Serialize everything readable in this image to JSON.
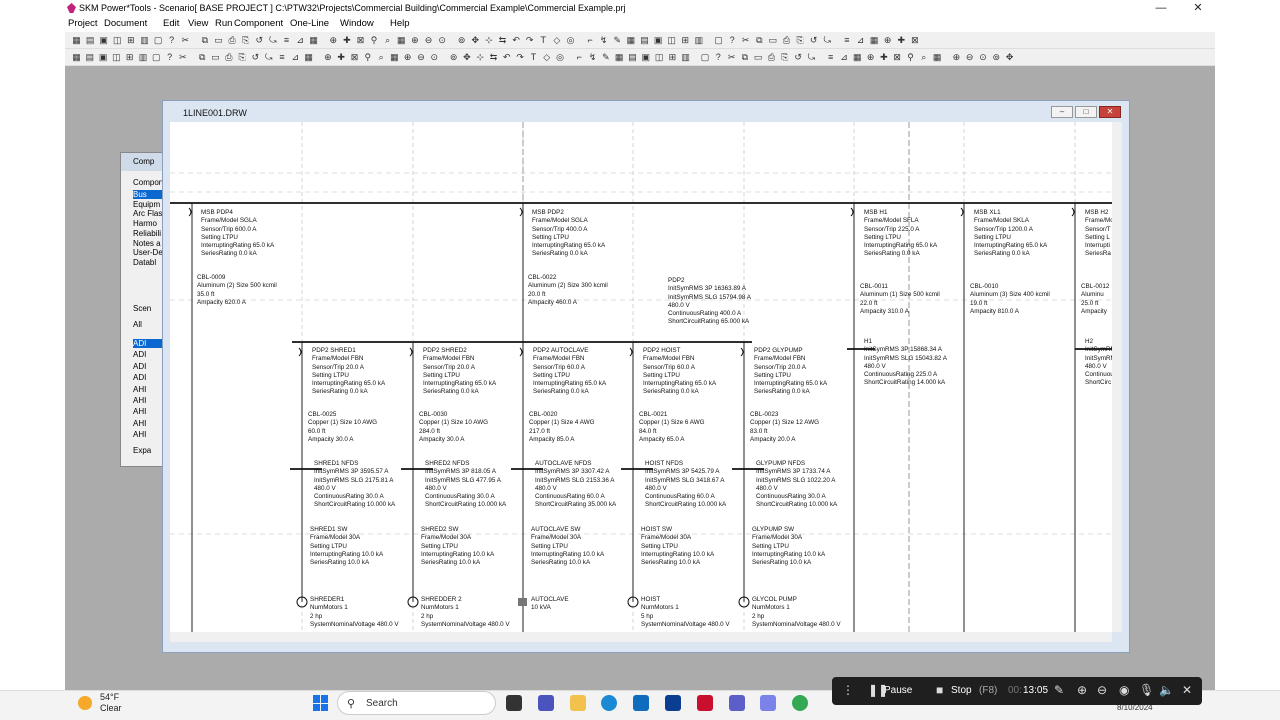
{
  "app": {
    "title": "SKM Power*Tools - Scenario[ BASE PROJECT ] C:\\PTW32\\Projects\\Commercial Building\\Commercial Example\\Commercial Example.prj",
    "menu": [
      "Project",
      "Document",
      "Edit",
      "View",
      "Run",
      "Component",
      "One-Line",
      "Window",
      "Help"
    ]
  },
  "side_panel": {
    "title": "Comp",
    "header": "Compon",
    "items": [
      "Bus",
      "Equipm",
      "Arc Flas",
      "Harmo",
      "Reliabili",
      "Notes a",
      "User-De",
      "Databl"
    ],
    "selected": "Bus",
    "tab": "Scen",
    "filter": "All",
    "list": [
      "ADI",
      "ADI",
      "ADI",
      "ADI",
      "AHI",
      "AHI",
      "AHI",
      "AHI",
      "AHI"
    ],
    "expand": "Expa"
  },
  "drawing": {
    "title": "1LINE001.DRW",
    "top_buses": [
      {
        "name": "MSB PDP4",
        "lines": [
          "Frame/Model SGLA",
          "Sensor/Trip 600.0 A",
          "Setting LTPU",
          "InterruptingRating 65.0 kA",
          "SeriesRating 0.0 kA"
        ]
      },
      {
        "name": "MSB PDP2",
        "lines": [
          "Frame/Model SGLA",
          "Sensor/Trip 400.0 A",
          "Setting LTPU",
          "InterruptingRating 65.0 kA",
          "SeriesRating 0.0 kA"
        ]
      },
      {
        "name": "MSB H1",
        "lines": [
          "Frame/Model SFLA",
          "Sensor/Trip 225.0 A",
          "Setting LTPU",
          "InterruptingRating 65.0 kA",
          "SeriesRating 0.0 kA"
        ]
      },
      {
        "name": "MSB XL1",
        "lines": [
          "Frame/Model SKLA",
          "Sensor/Trip 1200.0 A",
          "Setting LTPU",
          "InterruptingRating 65.0 kA",
          "SeriesRating 0.0 kA"
        ]
      },
      {
        "name": "MSB H2",
        "lines": [
          "Frame/Model",
          "Sensor/T",
          "Setting L",
          "Interrupti",
          "SeriesRa"
        ]
      }
    ],
    "top_cables": [
      {
        "name": "CBL-0009",
        "lines": [
          "Aluminum (2) Size 500 kcmil",
          "35.0 ft",
          "Ampacity 620.0 A"
        ]
      },
      {
        "name": "CBL-0022",
        "lines": [
          "Aluminum (2) Size 300 kcmil",
          "20.0 ft",
          "Ampacity 460.0 A"
        ]
      },
      {
        "name": "CBL-0011",
        "lines": [
          "Aluminum (1) Size 500 kcmil",
          "22.0 ft",
          "Ampacity 310.0 A"
        ]
      },
      {
        "name": "CBL-0010",
        "lines": [
          "Aluminum (3) Size 400 kcmil",
          "19.0 ft",
          "Ampacity 810.0 A"
        ]
      },
      {
        "name": "CBL-0012",
        "lines": [
          "Aluminu",
          "25.0 ft",
          "Ampacity"
        ]
      }
    ],
    "pdp2_bus": {
      "name": "PDP2",
      "lines": [
        "InitSymRMS 3P 16363.89 A",
        "InitSymRMS SLG 15794.98 A",
        "480.0 V",
        "ContinuousRating 400.0 A",
        "ShortCircuitRating 65.000 kA"
      ]
    },
    "h1_bus": {
      "name": "H1",
      "lines": [
        "InitSymRMS 3P 15868.34 A",
        "InitSymRMS SLG 15043.82 A",
        "480.0 V",
        "ContinuousRating 225.0 A",
        "ShortCircuitRating 14.000 kA"
      ]
    },
    "h2_bus": {
      "name": "H2",
      "lines": [
        "InitSymRM",
        "InitSymRM",
        "480.0 V",
        "Continuou",
        "ShortCirc"
      ]
    },
    "branches": [
      {
        "breaker": {
          "name": "PDP2 SHRED1",
          "lines": [
            "Frame/Model FBN",
            "Sensor/Trip 20.0 A",
            "Setting LTPU",
            "InterruptingRating 65.0 kA",
            "SeriesRating 0.0 kA"
          ]
        },
        "cable": {
          "name": "CBL-0025",
          "lines": [
            "Copper (1) Size 10 AWG",
            "60.0 ft",
            "Ampacity 30.0 A"
          ]
        },
        "bus": {
          "name": "SHRED1 NFDS",
          "lines": [
            "InitSymRMS 3P 3595.57 A",
            "InitSymRMS SLG 2175.81 A",
            "480.0 V",
            "ContinuousRating 30.0 A",
            "ShortCircuitRating 10.000 kA"
          ]
        },
        "switch": {
          "name": "SHRED1 SW",
          "lines": [
            "Frame/Model 30A",
            "Setting LTPU",
            "InterruptingRating 10.0 kA",
            "SeriesRating 10.0 kA"
          ]
        },
        "load": {
          "name": "SHREDER1",
          "lines": [
            "NumMotors 1",
            "2 hp",
            "SystemNominalVoltage 480.0 V"
          ]
        }
      },
      {
        "breaker": {
          "name": "PDP2 SHRED2",
          "lines": [
            "Frame/Model FBN",
            "Sensor/Trip 20.0 A",
            "Setting LTPU",
            "InterruptingRating 65.0 kA",
            "SeriesRating 0.0 kA"
          ]
        },
        "cable": {
          "name": "CBL-0030",
          "lines": [
            "Copper (1) Size 10 AWG",
            "284.0 ft",
            "Ampacity 30.0 A"
          ]
        },
        "bus": {
          "name": "SHRED2 NFDS",
          "lines": [
            "InitSymRMS 3P 818.05 A",
            "InitSymRMS SLG 477.95 A",
            "480.0 V",
            "ContinuousRating 30.0 A",
            "ShortCircuitRating 10.000 kA"
          ]
        },
        "switch": {
          "name": "SHRED2 SW",
          "lines": [
            "Frame/Model 30A",
            "Setting LTPU",
            "InterruptingRating 10.0 kA",
            "SeriesRating 10.0 kA"
          ]
        },
        "load": {
          "name": "SHREDDER 2",
          "lines": [
            "NumMotors 1",
            "2 hp",
            "SystemNominalVoltage 480.0 V"
          ]
        }
      },
      {
        "breaker": {
          "name": "PDP2 AUTOCLAVE",
          "lines": [
            "Frame/Model FBN",
            "Sensor/Trip 60.0 A",
            "Setting LTPU",
            "InterruptingRating 65.0 kA",
            "SeriesRating 0.0 kA"
          ]
        },
        "cable": {
          "name": "CBL-0020",
          "lines": [
            "Copper (1) Size 4 AWG",
            "217.0 ft",
            "Ampacity 85.0 A"
          ]
        },
        "bus": {
          "name": "AUTOCLAVE NFDS",
          "lines": [
            "InitSymRMS 3P 3307.42 A",
            "InitSymRMS SLG 2153.36 A",
            "480.0 V",
            "ContinuousRating 60.0 A",
            "ShortCircuitRating 35.000 kA"
          ]
        },
        "switch": {
          "name": "AUTOCLAVE SW",
          "lines": [
            "Frame/Model 30A",
            "Setting LTPU",
            "InterruptingRating 10.0 kA",
            "SeriesRating 10.0 kA"
          ]
        },
        "load": {
          "name": "AUTOCLAVE",
          "lines": [
            "10 kVA"
          ]
        }
      },
      {
        "breaker": {
          "name": "PDP2 HOIST",
          "lines": [
            "Frame/Model FBN",
            "Sensor/Trip 60.0 A",
            "Setting LTPU",
            "InterruptingRating 65.0 kA",
            "SeriesRating 0.0 kA"
          ]
        },
        "cable": {
          "name": "CBL-0021",
          "lines": [
            "Copper (1) Size 6 AWG",
            "84.0 ft",
            "Ampacity 65.0 A"
          ]
        },
        "bus": {
          "name": "HOIST NFDS",
          "lines": [
            "InitSymRMS 3P 5425.79 A",
            "InitSymRMS SLG 3418.67 A",
            "480.0 V",
            "ContinuousRating 60.0 A",
            "ShortCircuitRating 10.000 kA"
          ]
        },
        "switch": {
          "name": "HOIST SW",
          "lines": [
            "Frame/Model 30A",
            "Setting LTPU",
            "InterruptingRating 10.0 kA",
            "SeriesRating 10.0 kA"
          ]
        },
        "load": {
          "name": "HOIST",
          "lines": [
            "NumMotors 1",
            "5 hp",
            "SystemNominalVoltage 480.0 V"
          ]
        }
      },
      {
        "breaker": {
          "name": "PDP2 GLYPUMP",
          "lines": [
            "Frame/Model FBN",
            "Sensor/Trip 20.0 A",
            "Setting LTPU",
            "InterruptingRating 65.0 kA",
            "SeriesRating 0.0 kA"
          ]
        },
        "cable": {
          "name": "CBL-0023",
          "lines": [
            "Copper (1) Size 12 AWG",
            "83.0 ft",
            "Ampacity 20.0 A"
          ]
        },
        "bus": {
          "name": "GLYPUMP NFDS",
          "lines": [
            "InitSymRMS 3P 1733.74 A",
            "InitSymRMS SLG 1022.20 A",
            "480.0 V",
            "ContinuousRating 30.0 A",
            "ShortCircuitRating 10.000 kA"
          ]
        },
        "switch": {
          "name": "GLYPUMP SW",
          "lines": [
            "Frame/Model 30A",
            "Setting LTPU",
            "InterruptingRating 10.0 kA",
            "SeriesRating 10.0 kA"
          ]
        },
        "load": {
          "name": "GLYCOL PUMP",
          "lines": [
            "NumMotors 1",
            "2 hp",
            "SystemNominalVoltage 480.0 V"
          ]
        }
      }
    ]
  },
  "taskbar": {
    "weather_temp": "54°F",
    "weather_desc": "Clear",
    "search_placeholder": "Search",
    "date": "8/10/2024"
  },
  "recorder": {
    "pause_label": "Pause",
    "stop_label": "Stop",
    "stop_key": "(F8)",
    "time_dim": "00:",
    "time": "13:05"
  }
}
